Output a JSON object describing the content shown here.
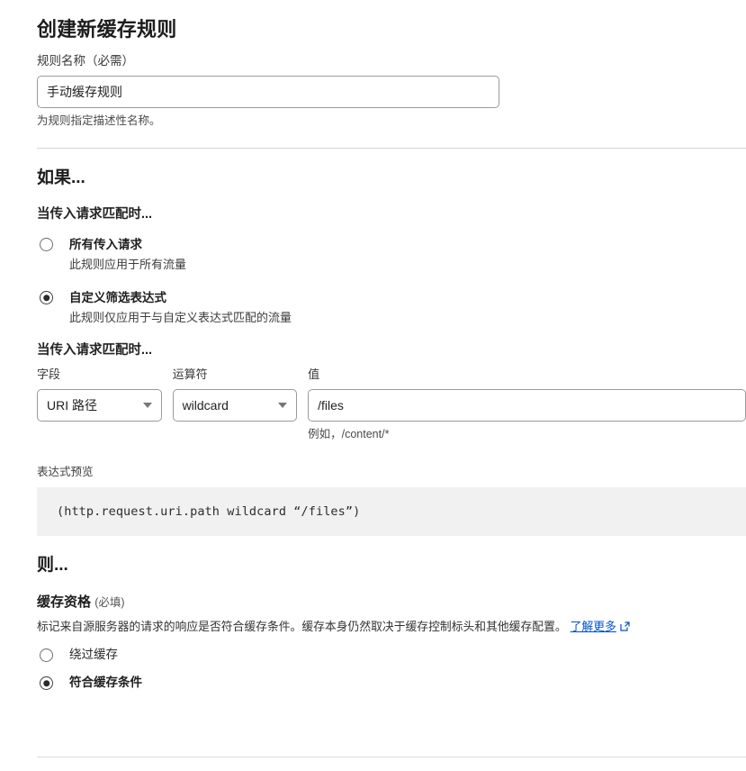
{
  "page": {
    "title": "创建新缓存规则"
  },
  "rule_name": {
    "label": "规则名称",
    "required_suffix": "（必需）",
    "value": "手动缓存规则",
    "placeholder": "",
    "hint": "为规则指定描述性名称。"
  },
  "if_section": {
    "title": "如果...",
    "subtitle": "当传入请求匹配时...",
    "options": [
      {
        "title": "所有传入请求",
        "desc": "此规则应用于所有流量",
        "selected": false
      },
      {
        "title": "自定义筛选表达式",
        "desc": "此规则仅应用于与自定义表达式匹配的流量",
        "selected": true
      }
    ]
  },
  "condition": {
    "heading": "当传入请求匹配时...",
    "field": {
      "label": "字段",
      "value": "URI 路径"
    },
    "operator": {
      "label": "运算符",
      "value": "wildcard"
    },
    "value": {
      "label": "值",
      "value": "/files",
      "placeholder": "",
      "hint": "例如，/content/*"
    }
  },
  "expression": {
    "label": "表达式预览",
    "text": "(http.request.uri.path wildcard “/files”)"
  },
  "then_section": {
    "title": "则...",
    "eligibility_label": "缓存资格",
    "eligibility_required": "(必填)",
    "description": "标记来自源服务器的请求的响应是否符合缓存条件。缓存本身仍然取决于缓存控制标头和其他缓存配置。",
    "learn_more": "了解更多",
    "options": [
      {
        "title": "绕过缓存",
        "selected": false
      },
      {
        "title": "符合缓存条件",
        "selected": true
      }
    ]
  },
  "colors": {
    "link": "#0051c3",
    "preview_bg": "#f1f1f1",
    "border": "#9a9a9a"
  }
}
